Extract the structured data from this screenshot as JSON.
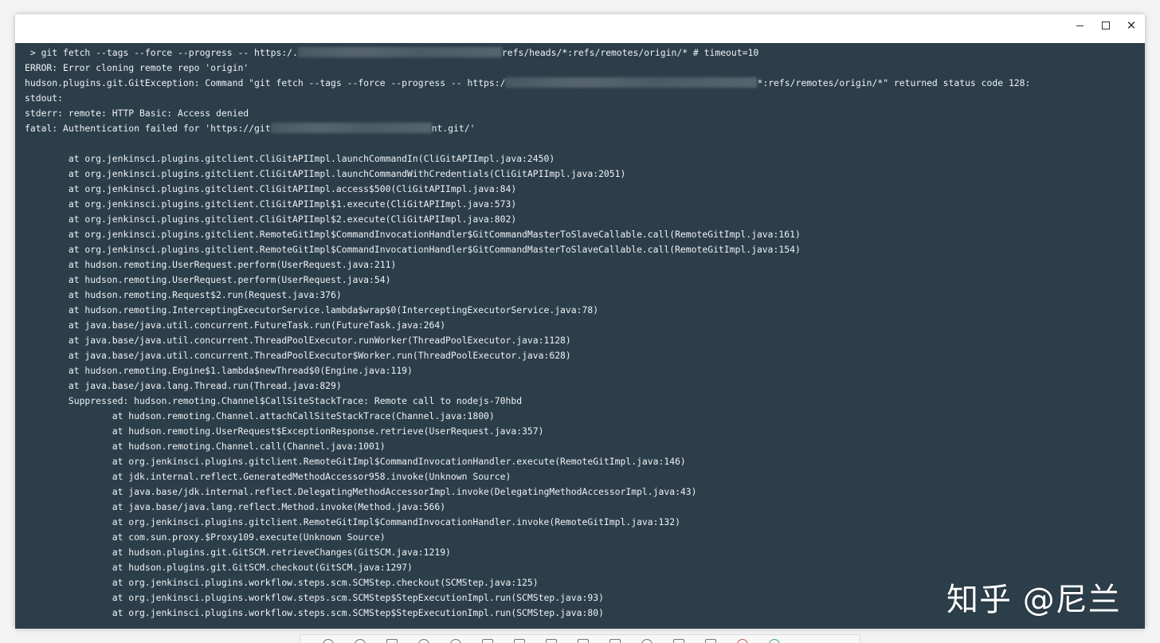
{
  "window": {
    "controls": {
      "minimize_icon": "minimize-icon",
      "maximize_icon": "maximize-icon",
      "close_icon": "close-icon",
      "close_glyph": "✕"
    }
  },
  "console": {
    "line1_prefix": " > git fetch --tags --force --progress -- https:/.",
    "line1_suffix": "refs/heads/*:refs/remotes/origin/* # timeout=10",
    "line2": "ERROR: Error cloning remote repo 'origin'",
    "line3_prefix": "hudson.plugins.git.GitException: Command \"git fetch --tags --force --progress -- https:/",
    "line3_suffix": "*:refs/remotes/origin/*\" returned status code 128:",
    "line4": "stdout:",
    "line5": "stderr: remote: HTTP Basic: Access denied",
    "line6_prefix": "fatal: Authentication failed for 'https://git",
    "line6_suffix": "nt.git/'",
    "stack": [
      "        at org.jenkinsci.plugins.gitclient.CliGitAPIImpl.launchCommandIn(CliGitAPIImpl.java:2450)",
      "        at org.jenkinsci.plugins.gitclient.CliGitAPIImpl.launchCommandWithCredentials(CliGitAPIImpl.java:2051)",
      "        at org.jenkinsci.plugins.gitclient.CliGitAPIImpl.access$500(CliGitAPIImpl.java:84)",
      "        at org.jenkinsci.plugins.gitclient.CliGitAPIImpl$1.execute(CliGitAPIImpl.java:573)",
      "        at org.jenkinsci.plugins.gitclient.CliGitAPIImpl$2.execute(CliGitAPIImpl.java:802)",
      "        at org.jenkinsci.plugins.gitclient.RemoteGitImpl$CommandInvocationHandler$GitCommandMasterToSlaveCallable.call(RemoteGitImpl.java:161)",
      "        at org.jenkinsci.plugins.gitclient.RemoteGitImpl$CommandInvocationHandler$GitCommandMasterToSlaveCallable.call(RemoteGitImpl.java:154)",
      "        at hudson.remoting.UserRequest.perform(UserRequest.java:211)",
      "        at hudson.remoting.UserRequest.perform(UserRequest.java:54)",
      "        at hudson.remoting.Request$2.run(Request.java:376)",
      "        at hudson.remoting.InterceptingExecutorService.lambda$wrap$0(InterceptingExecutorService.java:78)",
      "        at java.base/java.util.concurrent.FutureTask.run(FutureTask.java:264)",
      "        at java.base/java.util.concurrent.ThreadPoolExecutor.runWorker(ThreadPoolExecutor.java:1128)",
      "        at java.base/java.util.concurrent.ThreadPoolExecutor$Worker.run(ThreadPoolExecutor.java:628)",
      "        at hudson.remoting.Engine$1.lambda$newThread$0(Engine.java:119)",
      "        at java.base/java.lang.Thread.run(Thread.java:829)",
      "        Suppressed: hudson.remoting.Channel$CallSiteStackTrace: Remote call to nodejs-70hbd",
      "                at hudson.remoting.Channel.attachCallSiteStackTrace(Channel.java:1800)",
      "                at hudson.remoting.UserRequest$ExceptionResponse.retrieve(UserRequest.java:357)",
      "                at hudson.remoting.Channel.call(Channel.java:1001)",
      "                at org.jenkinsci.plugins.gitclient.RemoteGitImpl$CommandInvocationHandler.execute(RemoteGitImpl.java:146)",
      "                at jdk.internal.reflect.GeneratedMethodAccessor958.invoke(Unknown Source)",
      "                at java.base/jdk.internal.reflect.DelegatingMethodAccessorImpl.invoke(DelegatingMethodAccessorImpl.java:43)",
      "                at java.base/java.lang.reflect.Method.invoke(Method.java:566)",
      "                at org.jenkinsci.plugins.gitclient.RemoteGitImpl$CommandInvocationHandler.invoke(RemoteGitImpl.java:132)",
      "                at com.sun.proxy.$Proxy109.execute(Unknown Source)",
      "                at hudson.plugins.git.GitSCM.retrieveChanges(GitSCM.java:1219)",
      "                at hudson.plugins.git.GitSCM.checkout(GitSCM.java:1297)",
      "                at org.jenkinsci.plugins.workflow.steps.scm.SCMStep.checkout(SCMStep.java:125)",
      "                at org.jenkinsci.plugins.workflow.steps.scm.SCMStep$StepExecutionImpl.run(SCMStep.java:93)",
      "                at org.jenkinsci.plugins.workflow.steps.scm.SCMStep$StepExecutionImpl.run(SCMStep.java:80)"
    ]
  },
  "watermark": "知乎 @尼兰",
  "colors": {
    "console_bg": "#2c3e4a",
    "console_text": "#eef2f4",
    "titlebar_bg": "#ffffff"
  },
  "taskbar": {
    "icons": [
      "circle-icon",
      "circle-icon",
      "square-icon",
      "circle-icon",
      "circle-icon",
      "arrow-icon",
      "pen-icon",
      "square-icon",
      "square-icon",
      "text-icon",
      "curve-icon",
      "pointer-icon",
      "scissors-icon",
      "close-icon",
      "check-icon"
    ]
  }
}
